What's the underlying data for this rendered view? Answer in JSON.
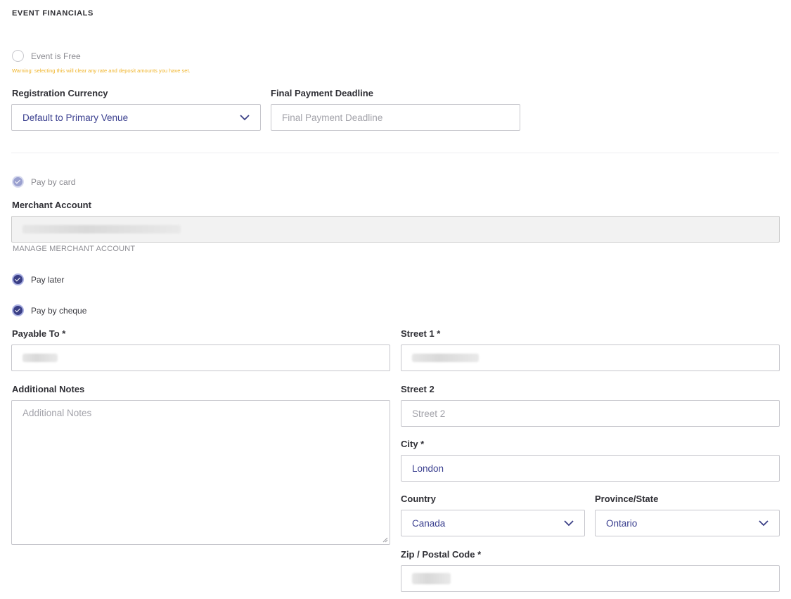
{
  "section": {
    "title": "EVENT FINANCIALS"
  },
  "event_free": {
    "label": "Event is Free",
    "checked": false,
    "warning": "Warning: selecting this will clear any rate and deposit amounts you have set."
  },
  "registration_currency": {
    "label": "Registration Currency",
    "value": "Default to Primary Venue"
  },
  "final_payment_deadline": {
    "label": "Final Payment Deadline",
    "placeholder": "Final Payment Deadline"
  },
  "pay_by_card": {
    "label": "Pay by card",
    "checked": true
  },
  "merchant_account": {
    "label": "Merchant Account",
    "manage_link": "MANAGE MERCHANT ACCOUNT"
  },
  "pay_later": {
    "label": "Pay later",
    "checked": true
  },
  "pay_by_cheque": {
    "label": "Pay by cheque",
    "checked": true
  },
  "payable_to": {
    "label": "Payable To *"
  },
  "street1": {
    "label": "Street 1 *"
  },
  "additional_notes": {
    "label": "Additional Notes",
    "placeholder": "Additional Notes"
  },
  "street2": {
    "label": "Street 2",
    "placeholder": "Street 2"
  },
  "city": {
    "label": "City *",
    "value": "London"
  },
  "country": {
    "label": "Country",
    "value": "Canada"
  },
  "province": {
    "label": "Province/State",
    "value": "Ontario"
  },
  "zip": {
    "label": "Zip / Postal Code *"
  },
  "icons": {
    "select_arrow": "chevron-down-icon",
    "check": "check-icon"
  },
  "colors": {
    "accent": "#3a3f86",
    "warning": "#f0b429",
    "value_text": "#3a3f8f"
  }
}
